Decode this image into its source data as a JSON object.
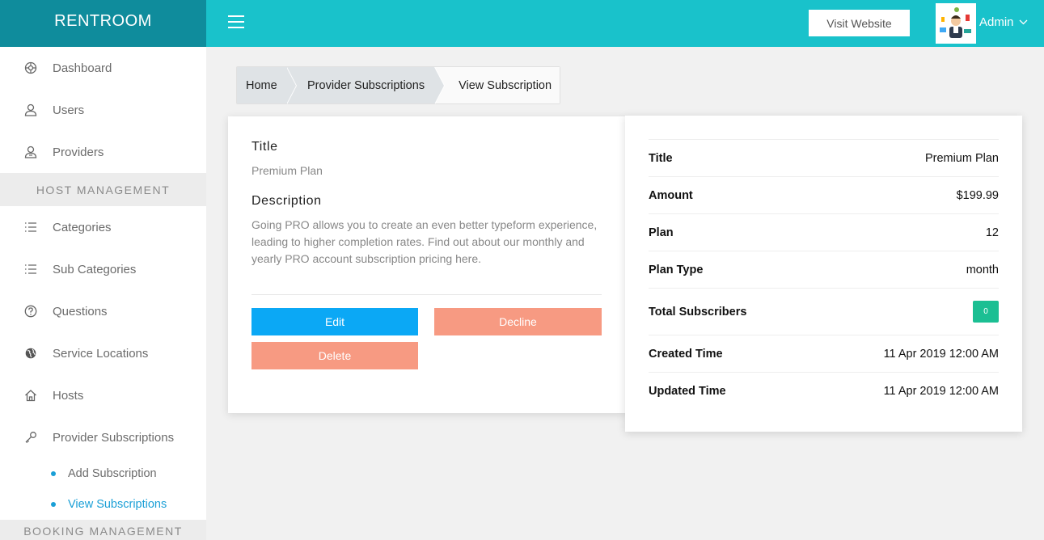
{
  "brand": "RENTROOM",
  "topbar": {
    "visit_website": "Visit Website",
    "user": "Admin"
  },
  "sidebar": {
    "items_top": [
      {
        "label": "Dashboard",
        "icon": "dashboard-icon"
      },
      {
        "label": "Users",
        "icon": "user-icon"
      },
      {
        "label": "Providers",
        "icon": "provider-icon"
      }
    ],
    "section_host": "HOST MANAGEMENT",
    "items_host": [
      {
        "label": "Categories",
        "icon": "list-icon"
      },
      {
        "label": "Sub Categories",
        "icon": "list-icon"
      },
      {
        "label": "Questions",
        "icon": "question-icon"
      },
      {
        "label": "Service Locations",
        "icon": "globe-icon"
      },
      {
        "label": "Hosts",
        "icon": "home-icon"
      },
      {
        "label": "Provider Subscriptions",
        "icon": "key-icon"
      }
    ],
    "sub_items": [
      {
        "label": "Add Subscription",
        "active": false
      },
      {
        "label": "View Subscriptions",
        "active": true
      }
    ],
    "section_booking": "BOOKING MANAGEMENT"
  },
  "breadcrumb": {
    "home": "Home",
    "parent": "Provider Subscriptions",
    "current": "View Subscription"
  },
  "detail": {
    "title_label": "Title",
    "title_value": "Premium Plan",
    "description_label": "Description",
    "description_value": "Going PRO allows you to create an even better typeform experience, leading to higher completion rates. Find out about our monthly and yearly PRO account subscription pricing here.",
    "edit": "Edit",
    "decline": "Decline",
    "delete": "Delete"
  },
  "summary": {
    "rows": [
      {
        "key": "Title",
        "value": "Premium Plan"
      },
      {
        "key": "Amount",
        "value": "$199.99"
      },
      {
        "key": "Plan",
        "value": "12"
      },
      {
        "key": "Plan Type",
        "value": "month"
      },
      {
        "key": "Total Subscribers",
        "value": "0"
      },
      {
        "key": "Created Time",
        "value": "11 Apr 2019 12:00 AM"
      },
      {
        "key": "Updated Time",
        "value": "11 Apr 2019 12:00 AM"
      }
    ]
  },
  "colors": {
    "brand_bg": "#0f8c9c",
    "topbar_bg": "#19c2cb",
    "edit_button": "#0ba8f5",
    "decline_button": "#f79a82",
    "badge": "#1bbf93",
    "active_link": "#1a9fd6"
  }
}
